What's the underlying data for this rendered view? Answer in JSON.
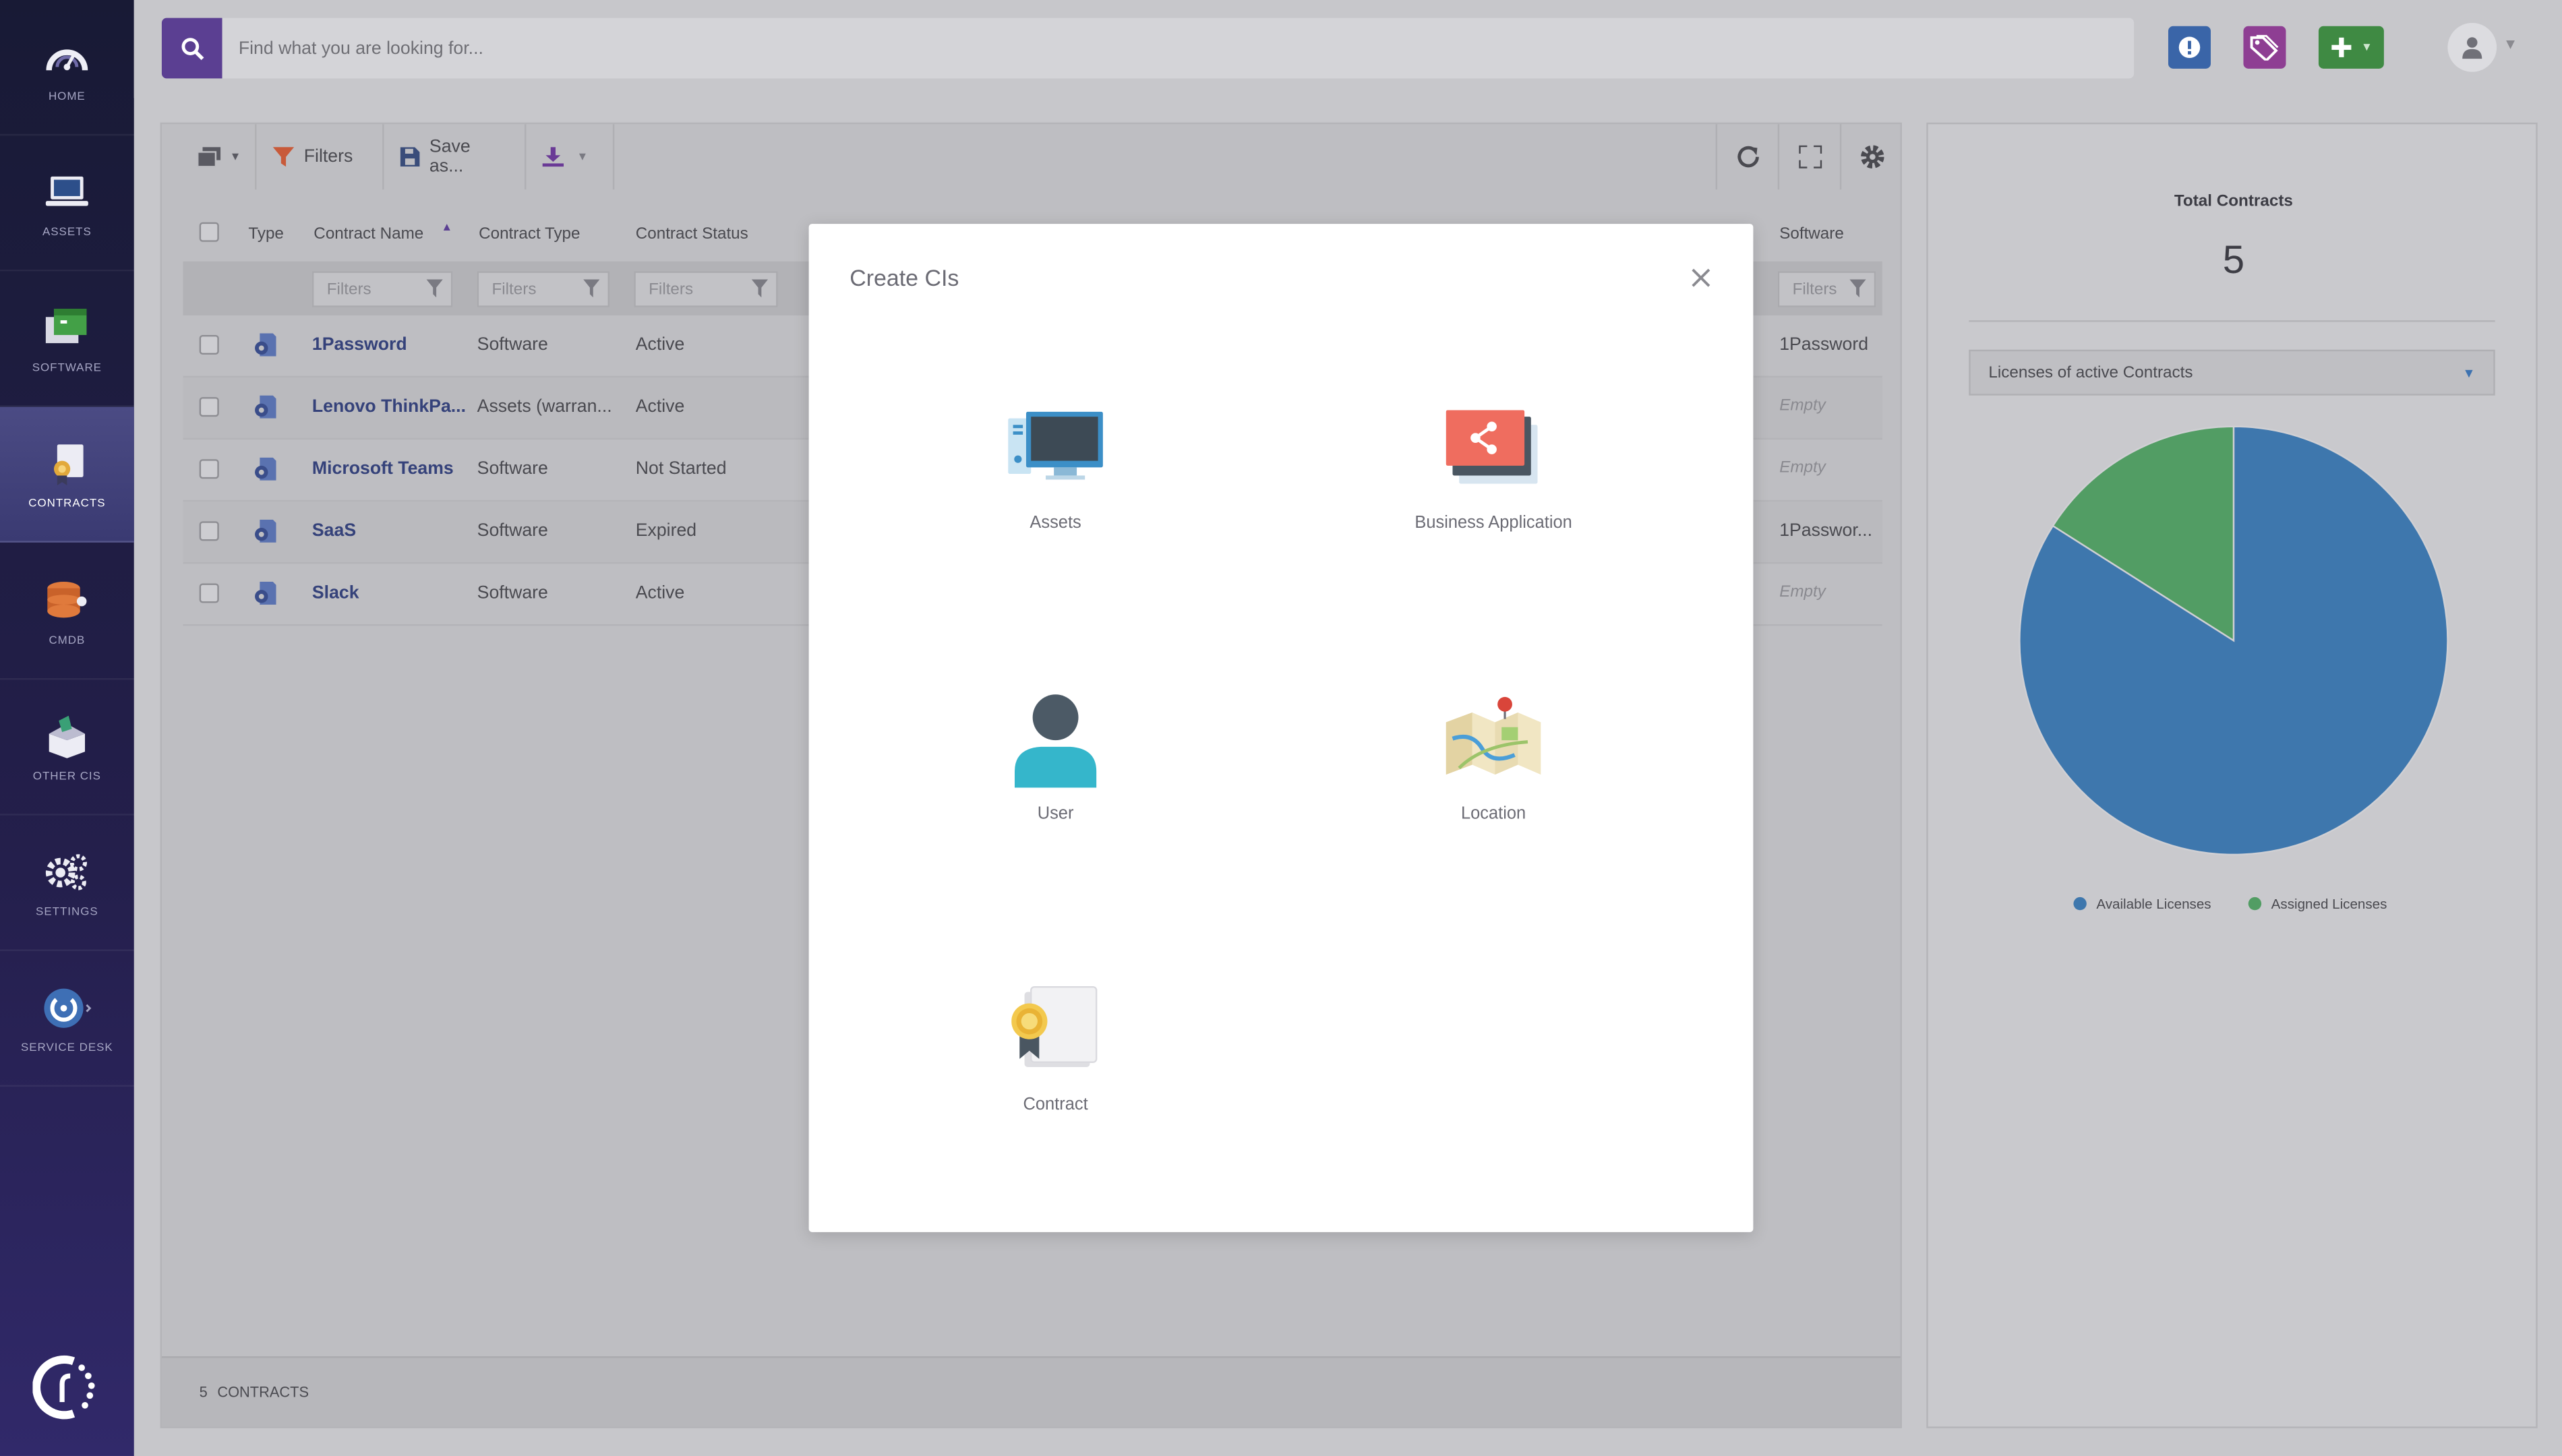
{
  "colors": {
    "sidebar_top": "#181a35",
    "sidebar_bottom": "#31296a",
    "search_button": "#5b3f92",
    "alert_button": "#3a65a8",
    "tag_button": "#8e3e93",
    "add_button": "#3f8a43",
    "link_text": "#35427a",
    "available_licenses": "#3e77ad",
    "assigned_licenses": "#529d64"
  },
  "sidebar": {
    "items": [
      {
        "label": "HOME",
        "icon": "speedometer-icon"
      },
      {
        "label": "ASSETS",
        "icon": "laptop-icon"
      },
      {
        "label": "SOFTWARE",
        "icon": "software-window-icon"
      },
      {
        "label": "CONTRACTS",
        "icon": "contract-certificate-icon",
        "active": true
      },
      {
        "label": "CMDB",
        "icon": "database-icon"
      },
      {
        "label": "OTHER CIs",
        "icon": "open-box-icon"
      },
      {
        "label": "SETTINGS",
        "icon": "gears-icon"
      },
      {
        "label": "SERVICE DESK",
        "icon": "service-desk-icon"
      }
    ],
    "logo": "invgate-logo"
  },
  "search": {
    "placeholder": "Find what you are looking for..."
  },
  "toolbar": {
    "filters_label": "Filters",
    "save_label": "Save as..."
  },
  "table": {
    "columns": [
      "Type",
      "Contract Name",
      "Contract Type",
      "Contract Status",
      "Software"
    ],
    "filter_placeholder": "Filters",
    "rows": [
      {
        "name": "1Password",
        "type": "Software",
        "status": "Active",
        "software": "1Password",
        "software_empty": false
      },
      {
        "name": "Lenovo ThinkPa...",
        "type": "Assets (warran...",
        "status": "Active",
        "software": "Empty",
        "software_empty": true
      },
      {
        "name": "Microsoft Teams",
        "type": "Software",
        "status": "Not Started",
        "software": "Empty",
        "software_empty": true
      },
      {
        "name": "SaaS",
        "type": "Software",
        "status": "Expired",
        "software": "1Passwor...",
        "software_empty": false
      },
      {
        "name": "Slack",
        "type": "Software",
        "status": "Active",
        "software": "Empty",
        "software_empty": true
      }
    ]
  },
  "footer": {
    "count": "5",
    "label": "CONTRACTS"
  },
  "summary": {
    "title": "Total Contracts",
    "total": "5",
    "select_value": "Licenses of active Contracts"
  },
  "chart_data": {
    "type": "pie",
    "slices": [
      {
        "name": "Available Licenses",
        "value": 84,
        "color": "#3e77ad"
      },
      {
        "name": "Assigned Licenses",
        "value": 16,
        "color": "#529d64"
      }
    ],
    "legend_position": "bottom"
  },
  "modal": {
    "title": "Create CIs",
    "items": [
      {
        "label": "Assets",
        "icon": "computer-monitor-icon"
      },
      {
        "label": "Business Application",
        "icon": "share-network-icon"
      },
      {
        "label": "User",
        "icon": "user-person-icon"
      },
      {
        "label": "Location",
        "icon": "map-pin-icon"
      },
      {
        "label": "Contract",
        "icon": "certificate-ribbon-icon"
      }
    ]
  }
}
